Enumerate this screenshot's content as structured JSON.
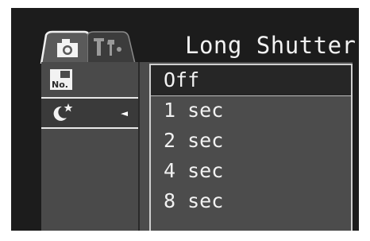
{
  "header": {
    "title": "Long Shutter"
  },
  "tabs": [
    {
      "name": "camera-tab",
      "icon": "camera-icon",
      "active": true
    },
    {
      "name": "setup-tab",
      "icon": "wrench-screwdriver-icon",
      "active": false
    }
  ],
  "sidebar": {
    "items": [
      {
        "icon": "file-number-icon",
        "icon_text": "No.",
        "selected": false
      },
      {
        "icon": "night-moon-star-icon",
        "selected": true,
        "arrow": "◄"
      }
    ]
  },
  "menu": {
    "options": [
      {
        "label": "Off",
        "highlighted": true
      },
      {
        "label": "1 sec",
        "highlighted": false
      },
      {
        "label": "2 sec",
        "highlighted": false
      },
      {
        "label": "4 sec",
        "highlighted": false
      },
      {
        "label": "8 sec",
        "highlighted": false
      }
    ]
  },
  "colors": {
    "background": "#1c1c1c",
    "panel": "#4c4c4c",
    "highlight": "#262626",
    "text": "#f2f2f2"
  }
}
